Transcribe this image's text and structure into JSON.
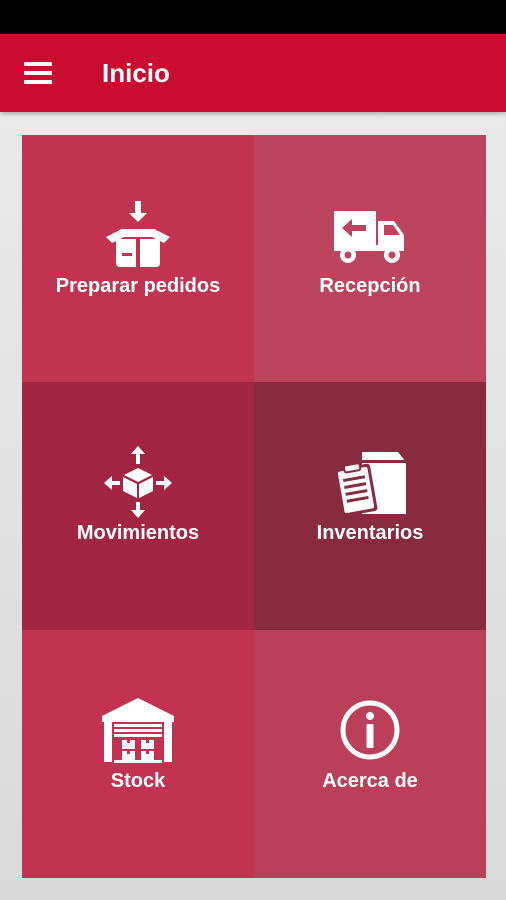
{
  "app": {
    "title": "Inicio"
  },
  "tiles": [
    {
      "label": "Preparar pedidos",
      "icon": "box-arrow-in-icon",
      "color": "#c23352"
    },
    {
      "label": "Recepción",
      "icon": "delivery-truck-icon",
      "color": "#bd445d"
    },
    {
      "label": "Movimientos",
      "icon": "cube-move-icon",
      "color": "#a22641"
    },
    {
      "label": "Inventarios",
      "icon": "clipboard-box-icon",
      "color": "#892b3e"
    },
    {
      "label": "Stock",
      "icon": "warehouse-icon",
      "color": "#c33251"
    },
    {
      "label": "Acerca de",
      "icon": "info-icon",
      "color": "#bb3f59"
    }
  ],
  "colors": {
    "appbar": "#c90c30",
    "statusbar": "#000000"
  }
}
